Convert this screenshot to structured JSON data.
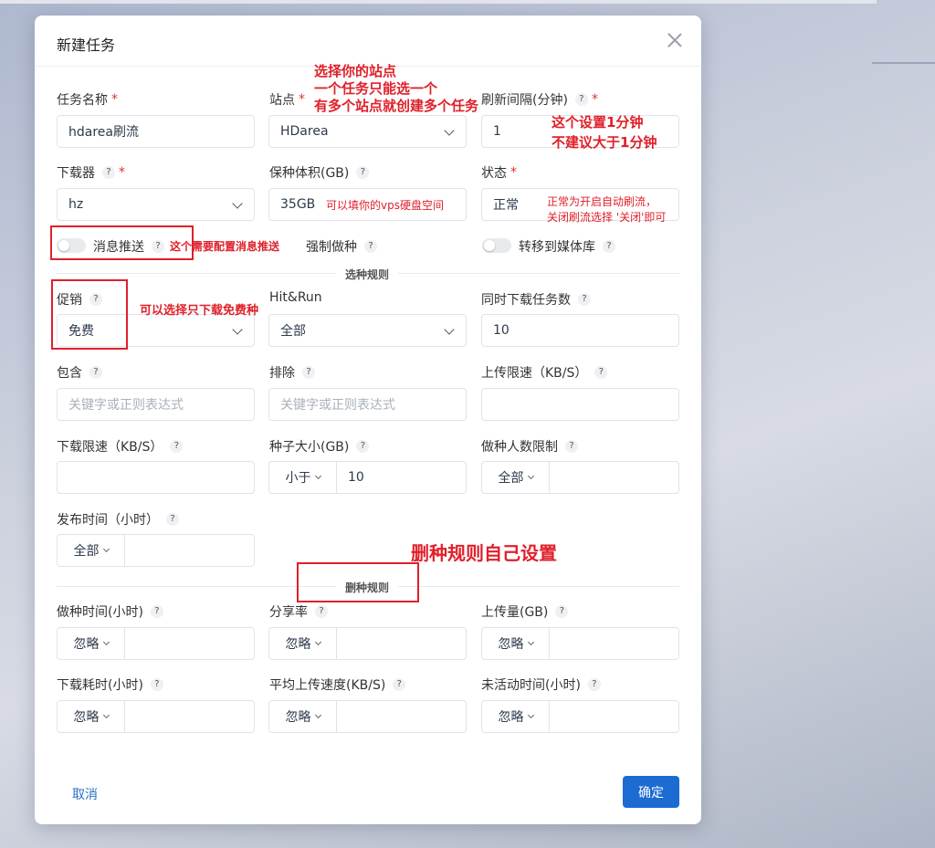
{
  "dialog": {
    "title": "新建任务",
    "cancel_label": "取消",
    "confirm_label": "确定"
  },
  "fields": {
    "task_name": {
      "label": "任务名称",
      "value": "hdarea刷流"
    },
    "site": {
      "label": "站点",
      "value": "HDarea"
    },
    "refresh_interval": {
      "label": "刷新间隔(分钟)",
      "value": "1"
    },
    "downloader": {
      "label": "下载器",
      "value": "hz"
    },
    "seed_volume": {
      "label": "保种体积(GB)",
      "value": "35GB"
    },
    "status": {
      "label": "状态",
      "value": "正常"
    },
    "message_push": {
      "label": "消息推送",
      "checked": false
    },
    "force_seed": {
      "label": "强制做种",
      "checked": false
    },
    "transfer_media": {
      "label": "转移到媒体库",
      "checked": false
    }
  },
  "select_rules": {
    "section_label": "选种规则",
    "promotion": {
      "label": "促销",
      "value": "免费"
    },
    "hitrun": {
      "label": "Hit&Run",
      "value": "全部"
    },
    "concurrent": {
      "label": "同时下载任务数",
      "value": "10"
    },
    "include": {
      "label": "包含",
      "placeholder": "关键字或正则表达式"
    },
    "exclude": {
      "label": "排除",
      "placeholder": "关键字或正则表达式"
    },
    "upload_limit": {
      "label": "上传限速（KB/S）",
      "value": ""
    },
    "download_limit": {
      "label": "下载限速（KB/S）",
      "value": ""
    },
    "torrent_size": {
      "label": "种子大小(GB)",
      "op": "小于",
      "value": "10"
    },
    "seeders_limit": {
      "label": "做种人数限制",
      "op": "全部",
      "value": ""
    },
    "publish_time": {
      "label": "发布时间（小时）",
      "op": "全部",
      "value": ""
    }
  },
  "delete_rules": {
    "section_label": "删种规则",
    "seed_time": {
      "label": "做种时间(小时)",
      "op": "忽略",
      "value": ""
    },
    "share_ratio": {
      "label": "分享率",
      "op": "忽略",
      "value": ""
    },
    "uploaded": {
      "label": "上传量(GB)",
      "op": "忽略",
      "value": ""
    },
    "download_time": {
      "label": "下载耗时(小时)",
      "op": "忽略",
      "value": ""
    },
    "avg_upload_speed": {
      "label": "平均上传速度(KB/S)",
      "op": "忽略",
      "value": ""
    },
    "inactive_time": {
      "label": "未活动时间(小时)",
      "op": "忽略",
      "value": ""
    }
  },
  "annotations": {
    "site_note": [
      "选择你的站点",
      "一个任务只能选一个",
      "有多个站点就创建多个任务"
    ],
    "interval_note": [
      "这个设置1分钟",
      "不建议大于1分钟"
    ],
    "vps_note": "可以填你的vps硬盘空间",
    "status_note": [
      "正常为开启自动刷流，",
      "关闭刷流选择 '关闭'即可"
    ],
    "push_note": "这个需要配置消息推送",
    "free_note": "可以选择只下载免费种",
    "delete_note": "删种规则自己设置"
  },
  "icons": {
    "help": "?",
    "close": "close-icon",
    "chevron": "chevron-down-icon"
  },
  "colors": {
    "primary": "#1c6bd1",
    "annotation": "#e0202a",
    "required": "#e03131"
  }
}
